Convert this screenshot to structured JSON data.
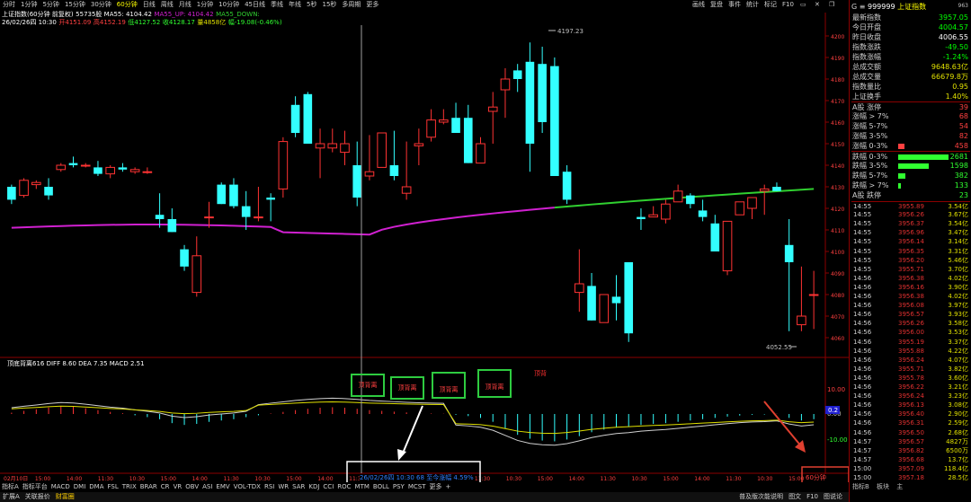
{
  "toolbar": {
    "items": [
      "分时",
      "1分钟",
      "5分钟",
      "15分钟",
      "30分钟",
      "60分钟",
      "日线",
      "周线",
      "月线",
      "1分钟",
      "10分钟",
      "45日线",
      "季线",
      "年线",
      "5秒",
      "15秒",
      "多周期",
      "更多"
    ],
    "selected_index": 5,
    "right_items": [
      "画线",
      "复盘",
      "事件",
      "统计",
      "标记",
      "F10"
    ]
  },
  "legend": {
    "index_name": "上证指数(60分钟 前复权)",
    "ma5_label": "55735股 MA55: 4104.42",
    "ma55_up": "MA55_UP: 4104.42",
    "ma55_down": "MA55_DOWN:",
    "bar_info_date": "26/02/26四 10:30",
    "bar_info_open": "开4151.09",
    "bar_info_high": "高4152.19",
    "bar_info_low": "低4127.52",
    "bar_info_close": "收4128.17",
    "bar_info_vol": "量4858亿",
    "bar_info_chg": "幅-19.08(-0.46%)"
  },
  "chart": {
    "price_ticks": [
      "4200",
      "4190",
      "4180",
      "4170",
      "4160",
      "4150",
      "4140",
      "4130",
      "4120",
      "4110",
      "4100",
      "4090",
      "4080",
      "4070",
      "4060"
    ],
    "high_annotation": "4197.23",
    "low_annotation": "4052.55",
    "macd_legend": "顶底背离616 DIFF 8.60 DEA 7.35 MACD 2.51",
    "macd_ticks": [
      "10.00",
      "0.00",
      "-10.00"
    ],
    "macd_current": "0.2",
    "divergence_labels": [
      "顶背离",
      "顶背离",
      "顶背离",
      "顶背离"
    ],
    "divergence_top": "顶背",
    "crosshair_tooltip": "26/02/26四 10:30 68 至今涨幅 4.59%",
    "time_labels": [
      "02月10日",
      "15:00",
      "14:00",
      "11:30",
      "10:30",
      "15:00",
      "14:00",
      "11:30",
      "10:30",
      "15:00",
      "14:00",
      "11:30",
      "10:30",
      "15:00",
      "14:00",
      "11:30",
      "10:30",
      "15:00",
      "14:00",
      "11:30",
      "10:30",
      "15:00",
      "14:00",
      "11:30",
      "10:30",
      "15:00"
    ],
    "period_label": "60分钟",
    "colors": {
      "up": "#ff3333",
      "down": "#33ffff",
      "ma_purple": "#d020d0",
      "ma_green": "#30d030"
    }
  },
  "chart_data": {
    "type": "candlestick",
    "candles": [
      [
        4130,
        4131,
        4122,
        4124
      ],
      [
        4126,
        4134,
        4125,
        4133
      ],
      [
        4131,
        4133,
        4129,
        4132
      ],
      [
        4130,
        4134,
        4124,
        4126
      ],
      [
        4138,
        4141,
        4137,
        4140
      ],
      [
        4141,
        4144,
        4139,
        4140
      ],
      [
        4140,
        4141,
        4139,
        4140
      ],
      [
        4139,
        4142,
        4135,
        4136
      ],
      [
        4136,
        4140,
        4134,
        4139
      ],
      [
        4139,
        4141,
        4137,
        4138
      ],
      [
        4137,
        4139,
        4136,
        4138
      ],
      [
        4137,
        4139,
        4136,
        4137
      ],
      [
        4117,
        4127,
        4111,
        4115
      ],
      [
        4115,
        4120,
        4109,
        4109
      ],
      [
        4101,
        4103,
        4091,
        4093
      ],
      [
        4081,
        4107,
        4079,
        4098
      ],
      [
        4116,
        4123,
        4111,
        4116
      ],
      [
        4131,
        4132,
        4122,
        4122
      ],
      [
        4131,
        4134,
        4120,
        4121
      ],
      [
        4121,
        4128,
        4110,
        4116
      ],
      [
        4116,
        4130,
        4114,
        4116
      ],
      [
        4125,
        4127,
        4114,
        4124
      ],
      [
        4129,
        4153,
        4125,
        4151
      ],
      [
        4168,
        4172,
        4153,
        4155
      ],
      [
        4173,
        4174,
        4150,
        4150
      ],
      [
        4148,
        4157,
        4134,
        4150
      ],
      [
        4148,
        4157,
        4146,
        4150
      ],
      [
        4146,
        4156,
        4140,
        4150
      ],
      [
        4140,
        4151,
        4121,
        4125
      ],
      [
        4135,
        4154,
        4133,
        4137
      ],
      [
        4139,
        4155,
        4140,
        4155
      ],
      [
        4140,
        4156,
        4133,
        4135
      ],
      [
        4127,
        4151,
        4124,
        4130
      ],
      [
        4149,
        4157,
        4140,
        4150
      ],
      [
        4153,
        4166,
        4151,
        4161
      ],
      [
        4160,
        4166,
        4159,
        4161
      ],
      [
        4162,
        4169,
        4155,
        4155
      ],
      [
        4162,
        4168,
        4141,
        4141
      ],
      [
        4141,
        4153,
        4141,
        4150
      ],
      [
        4165,
        4174,
        4150,
        4167
      ],
      [
        4175,
        4185,
        4162,
        4180
      ],
      [
        4184,
        4187,
        4174,
        4180
      ],
      [
        4188,
        4197,
        4137,
        4150
      ],
      [
        4187,
        4195,
        4155,
        4160
      ],
      [
        4186,
        4190,
        4135,
        4135
      ],
      [
        4137,
        4140,
        4122,
        4124
      ],
      [
        4081,
        4101,
        4072,
        4085
      ],
      [
        4084,
        4090,
        4068,
        4068
      ],
      [
        4067,
        4080,
        4067,
        4080
      ],
      [
        4079,
        4089,
        4068,
        4076
      ],
      [
        4095,
        4095,
        4058,
        4062
      ],
      [
        4116,
        4120,
        4110,
        4115
      ],
      [
        4116,
        4121,
        4117,
        4117
      ],
      [
        4115,
        4124,
        4113,
        4122
      ],
      [
        4123,
        4131,
        4123,
        4128
      ],
      [
        4126,
        4127,
        4120,
        4122
      ],
      [
        4119,
        4124,
        4114,
        4116
      ],
      [
        4113,
        4117,
        4100,
        4100
      ],
      [
        4091,
        4114,
        4089,
        4114
      ],
      [
        4117,
        4123,
        4117,
        4123
      ],
      [
        4120,
        4125,
        4115,
        4125
      ],
      [
        4128,
        4131,
        4117,
        4129
      ],
      [
        4130,
        4132,
        4128,
        4128
      ],
      [
        4103,
        4115,
        4063,
        4095
      ],
      [
        4066,
        4093,
        4063,
        4070
      ],
      [
        4080,
        4091,
        4064,
        4080
      ]
    ],
    "ma_line_start": 4111,
    "ma_line_end": 4129,
    "ylim": [
      4055,
      4205
    ],
    "macd_bars_sample": [
      0.5,
      1.2,
      1.8,
      2.5,
      3.0,
      2.8,
      2.2,
      1.5,
      0.8,
      0.3,
      -0.5,
      -1.2,
      -2.0,
      -3.5,
      -4.2,
      -3.8,
      -3.0,
      -2.5,
      -2.0,
      -1.2,
      -0.5,
      0.2,
      0.8,
      1.5,
      2.0,
      2.4,
      2.6,
      2.4,
      2.0,
      1.5,
      1.2,
      0.9,
      0.6,
      0.4,
      0.2,
      0.1,
      -0.3,
      -0.8,
      -1.5,
      -3.0,
      -5.5,
      -8.0,
      -9.5,
      -10.2,
      -10.5,
      -9.8,
      -8.5,
      -7.0,
      -6.0,
      -5.2,
      -4.8,
      -4.2,
      -3.8,
      -3.5,
      -3.0,
      -2.5,
      -2.0,
      -1.5,
      -1.0,
      -0.6,
      -0.3,
      -0.2,
      0.1,
      -1.5,
      -2.5,
      -2.0
    ]
  },
  "panel": {
    "code": "999999",
    "name": "上证指数",
    "num": "963",
    "rows": [
      {
        "label": "最新指数",
        "value": "3957.05",
        "color": "#00ff00"
      },
      {
        "label": "今日开盘",
        "value": "4004.57",
        "color": "#00ff00"
      },
      {
        "label": "昨日收盘",
        "value": "4006.55",
        "color": "#ffffff"
      },
      {
        "label": "指数涨跌",
        "value": "-49.50",
        "color": "#00ff00"
      },
      {
        "label": "指数涨幅",
        "value": "-1.24%",
        "color": "#00ff00"
      },
      {
        "label": "总成交额",
        "value": "9648.63亿",
        "color": "#e0e000"
      },
      {
        "label": "总成交量",
        "value": "66679.8万",
        "color": "#e0e000"
      },
      {
        "label": "指数量比",
        "value": "0.95",
        "color": "#e0e000"
      },
      {
        "label": "上证换手",
        "value": "1.40%",
        "color": "#e0e000"
      }
    ],
    "breadth": [
      {
        "label": "A股 涨停",
        "value": "39",
        "color": "#ff4040",
        "bar": 0
      },
      {
        "label": "涨幅 > 7%",
        "value": "68",
        "color": "#ff4040",
        "bar": 0
      },
      {
        "label": "涨幅 5-7%",
        "value": "54",
        "color": "#ff4040",
        "bar": 0
      },
      {
        "label": "涨幅 3-5%",
        "value": "82",
        "color": "#ff4040",
        "bar": 0
      },
      {
        "label": "涨幅 0-3%",
        "value": "458",
        "color": "#ff4040",
        "bar": 0.12
      },
      {
        "label": "跌幅 0-3%",
        "value": "2681",
        "color": "#30ff30",
        "bar": 1.0
      },
      {
        "label": "跌幅 3-5%",
        "value": "1598",
        "color": "#30ff30",
        "bar": 0.6
      },
      {
        "label": "跌幅 5-7%",
        "value": "382",
        "color": "#30ff30",
        "bar": 0.14
      },
      {
        "label": "跌幅 > 7%",
        "value": "133",
        "color": "#30ff30",
        "bar": 0.05
      },
      {
        "label": "A股 跌停",
        "value": "23",
        "color": "#30ff30",
        "bar": 0
      }
    ],
    "ticks": [
      [
        "14:55",
        "3955.89",
        "3.54亿"
      ],
      [
        "14:55",
        "3956.26",
        "3.67亿"
      ],
      [
        "14:55",
        "3956.37",
        "3.54亿"
      ],
      [
        "14:55",
        "3956.96",
        "3.47亿"
      ],
      [
        "14:55",
        "3956.14",
        "3.14亿"
      ],
      [
        "14:55",
        "3956.35",
        "3.31亿"
      ],
      [
        "14:55",
        "3956.20",
        "5.46亿"
      ],
      [
        "14:55",
        "3955.71",
        "3.70亿"
      ],
      [
        "14:56",
        "3956.38",
        "4.02亿"
      ],
      [
        "14:56",
        "3956.16",
        "3.90亿"
      ],
      [
        "14:56",
        "3956.38",
        "4.02亿"
      ],
      [
        "14:56",
        "3956.08",
        "3.97亿"
      ],
      [
        "14:56",
        "3956.57",
        "3.93亿"
      ],
      [
        "14:56",
        "3956.26",
        "3.58亿"
      ],
      [
        "14:56",
        "3956.00",
        "3.53亿"
      ],
      [
        "14:56",
        "3955.19",
        "3.37亿"
      ],
      [
        "14:56",
        "3955.88",
        "4.22亿"
      ],
      [
        "14:56",
        "3956.24",
        "4.07亿"
      ],
      [
        "14:56",
        "3955.71",
        "3.82亿"
      ],
      [
        "14:56",
        "3955.78",
        "3.60亿"
      ],
      [
        "14:56",
        "3956.22",
        "3.21亿"
      ],
      [
        "14:56",
        "3956.24",
        "3.23亿"
      ],
      [
        "14:56",
        "3956.13",
        "3.08亿"
      ],
      [
        "14:56",
        "3956.40",
        "2.90亿"
      ],
      [
        "14:56",
        "3956.31",
        "2.59亿"
      ],
      [
        "14:56",
        "3956.50",
        "2.68亿"
      ],
      [
        "14:57",
        "3956.57",
        "4827万"
      ],
      [
        "14:57",
        "3956.82",
        "6500万"
      ],
      [
        "14:57",
        "3956.68",
        "13.7亿"
      ],
      [
        "15:00",
        "3957.09",
        "118.4亿"
      ],
      [
        "15:00",
        "3957.18",
        "28.5亿"
      ]
    ],
    "bottom_tabs": [
      "指标B",
      "板块",
      "主"
    ]
  },
  "bottombar": {
    "items": [
      "指标A",
      "指标平台",
      "MACD",
      "DMI",
      "DMA",
      "FSL",
      "TRIX",
      "BRAR",
      "CR",
      "VR",
      "OBV",
      "ASI",
      "EMV",
      "VOL-TDX",
      "RSI",
      "WR",
      "SAR",
      "KDJ",
      "CCI",
      "ROC",
      "MTM",
      "BOLL",
      "PSY",
      "MCST",
      "更多",
      "+"
    ]
  },
  "bottombar2": {
    "items": [
      "扩展A",
      "关联报价",
      "财富圈"
    ],
    "right_items": [
      "普及版次能说明",
      "图文",
      "F10",
      "图说论"
    ]
  }
}
